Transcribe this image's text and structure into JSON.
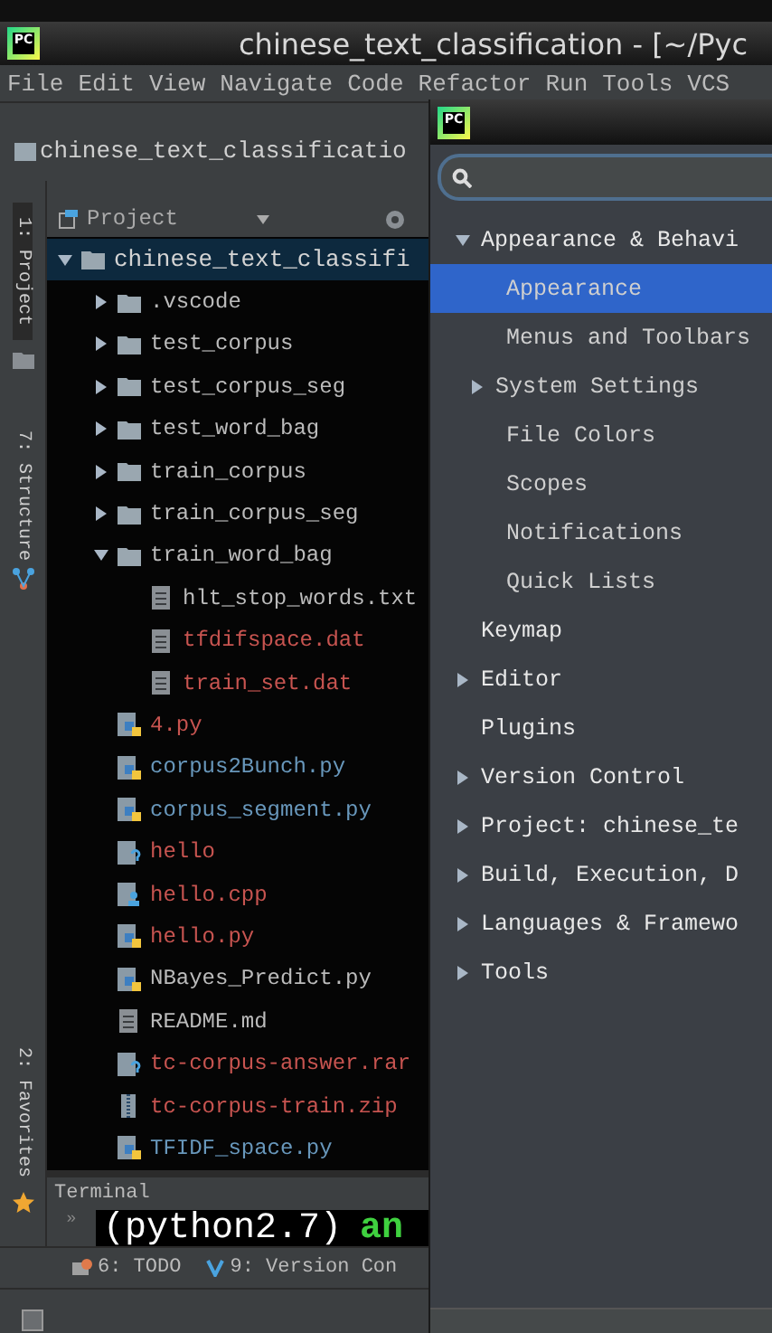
{
  "window": {
    "logo": "PC",
    "title": "chinese_text_classification - [~/Pyc"
  },
  "menu": [
    "File",
    "Edit",
    "View",
    "Navigate",
    "Code",
    "Refactor",
    "Run",
    "Tools",
    "VCS"
  ],
  "breadcrumb": "chinese_text_classificatio",
  "side_tabs": [
    {
      "label": "1: Project",
      "selected": true
    },
    {
      "label": "7: Structure",
      "selected": false
    }
  ],
  "favorites_tab": {
    "label": "2: Favorites",
    "selected": false
  },
  "project": {
    "title": "Project",
    "tree": [
      {
        "name": "chinese_text_classifi",
        "kind": "folder",
        "expanded": true,
        "selected": true,
        "color": "#d4d4d4",
        "children": [
          {
            "name": ".vscode",
            "kind": "folder",
            "expanded": false,
            "selected": false,
            "color": "#bbbbbb"
          },
          {
            "name": "test_corpus",
            "kind": "folder",
            "expanded": false,
            "selected": false,
            "color": "#bbbbbb"
          },
          {
            "name": "test_corpus_seg",
            "kind": "folder",
            "expanded": false,
            "selected": false,
            "color": "#bbbbbb"
          },
          {
            "name": "test_word_bag",
            "kind": "folder",
            "expanded": false,
            "selected": false,
            "color": "#bbbbbb"
          },
          {
            "name": "train_corpus",
            "kind": "folder",
            "expanded": false,
            "selected": false,
            "color": "#bbbbbb"
          },
          {
            "name": "train_corpus_seg",
            "kind": "folder",
            "expanded": false,
            "selected": false,
            "color": "#bbbbbb"
          },
          {
            "name": "train_word_bag",
            "kind": "folder",
            "expanded": true,
            "selected": false,
            "color": "#bbbbbb",
            "children": [
              {
                "name": "hlt_stop_words.txt",
                "kind": "text",
                "selected": false,
                "color": "#bbbbbb"
              },
              {
                "name": "tfdifspace.dat",
                "kind": "text",
                "selected": false,
                "color": "#c75450"
              },
              {
                "name": "train_set.dat",
                "kind": "text",
                "selected": false,
                "color": "#c75450"
              }
            ]
          },
          {
            "name": "4.py",
            "kind": "python",
            "selected": false,
            "color": "#c75450"
          },
          {
            "name": "corpus2Bunch.py",
            "kind": "python",
            "selected": false,
            "color": "#6897bb"
          },
          {
            "name": "corpus_segment.py",
            "kind": "python",
            "selected": false,
            "color": "#6897bb"
          },
          {
            "name": "hello",
            "kind": "unknown",
            "selected": false,
            "color": "#c75450"
          },
          {
            "name": "hello.cpp",
            "kind": "cpp",
            "selected": false,
            "color": "#c75450"
          },
          {
            "name": "hello.py",
            "kind": "python",
            "selected": false,
            "color": "#c75450"
          },
          {
            "name": "NBayes_Predict.py",
            "kind": "python",
            "selected": false,
            "color": "#bbbbbb"
          },
          {
            "name": "README.md",
            "kind": "text",
            "selected": false,
            "color": "#bbbbbb"
          },
          {
            "name": "tc-corpus-answer.rar",
            "kind": "unknown",
            "selected": false,
            "color": "#c75450"
          },
          {
            "name": "tc-corpus-train.zip",
            "kind": "archive",
            "selected": false,
            "color": "#c75450"
          },
          {
            "name": "TFIDF_space.py",
            "kind": "python",
            "selected": false,
            "color": "#6897bb"
          }
        ]
      }
    ]
  },
  "terminal": {
    "title": "Terminal",
    "prompt": "»",
    "env": "(python2.7)",
    "user": "an"
  },
  "bottom_tabs": [
    {
      "label": "6: TODO",
      "kind": "todo"
    },
    {
      "label": "9: Version Con",
      "kind": "vcs"
    }
  ],
  "settings": {
    "logo": "PC",
    "items": [
      {
        "label": "Appearance & Behavi",
        "expanded": true,
        "selected": false,
        "children": [
          {
            "label": "Appearance",
            "selected": true
          },
          {
            "label": "Menus and Toolbars",
            "selected": false
          },
          {
            "label": "System Settings",
            "expanded": false,
            "selected": false
          },
          {
            "label": "File Colors",
            "selected": false
          },
          {
            "label": "Scopes",
            "selected": false
          },
          {
            "label": "Notifications",
            "selected": false
          },
          {
            "label": "Quick Lists",
            "selected": false
          }
        ]
      },
      {
        "label": "Keymap",
        "selected": false
      },
      {
        "label": "Editor",
        "expanded": false,
        "selected": false
      },
      {
        "label": "Plugins",
        "selected": false
      },
      {
        "label": "Version Control",
        "expanded": false,
        "selected": false
      },
      {
        "label": "Project: chinese_te",
        "expanded": false,
        "selected": false
      },
      {
        "label": "Build, Execution, D",
        "expanded": false,
        "selected": false
      },
      {
        "label": "Languages & Framewo",
        "expanded": false,
        "selected": false
      },
      {
        "label": "Tools",
        "expanded": false,
        "selected": false
      }
    ]
  }
}
